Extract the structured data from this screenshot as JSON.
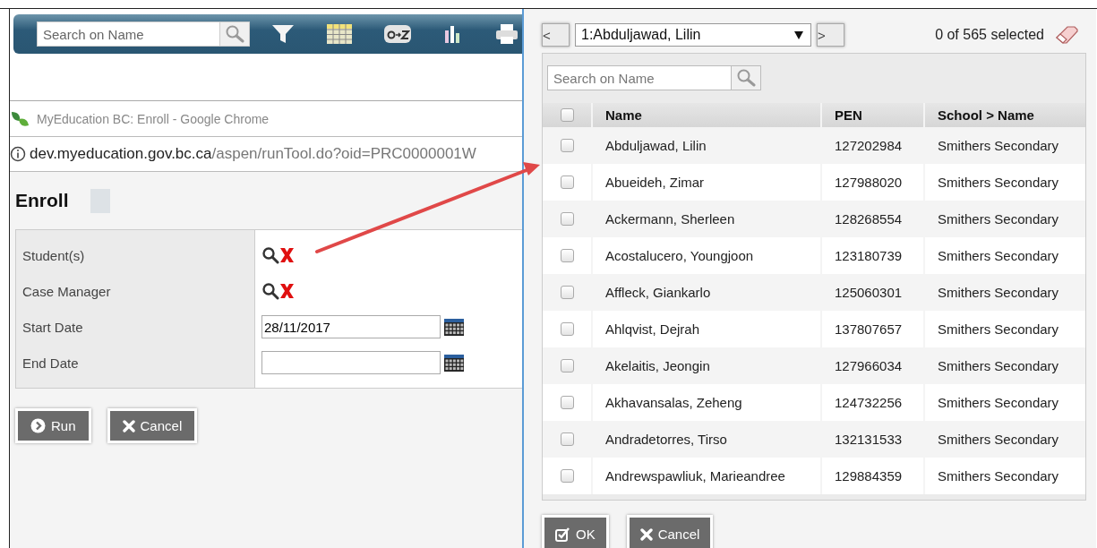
{
  "toolbar": {
    "search": {
      "placeholder": "Search on Name"
    }
  },
  "browser": {
    "title": "MyEducation BC: Enroll - Google Chrome",
    "url_host": "dev.myeducation.gov.bc.ca",
    "url_path": "/aspen/runTool.do?oid=PRC0000001W"
  },
  "page": {
    "title": "Enroll"
  },
  "form": {
    "fields": [
      {
        "label": "Student(s)",
        "kind": "picker"
      },
      {
        "label": "Case Manager",
        "kind": "picker"
      },
      {
        "label": "Start Date",
        "kind": "date",
        "value": "28/11/2017"
      },
      {
        "label": "End Date",
        "kind": "date"
      }
    ]
  },
  "buttons": [
    {
      "label": "Run",
      "kind": "run"
    },
    {
      "label": "Cancel",
      "kind": "cancel"
    }
  ],
  "picker": {
    "prev": "<",
    "current": "1:Abduljawad, Lilin",
    "next": ">",
    "selection_count": "0 of 565 selected",
    "search": {
      "placeholder": "Search on Name"
    },
    "select_all": {
      "checked": false
    },
    "columns": [
      "Name",
      "PEN",
      "School > Name"
    ],
    "rows": [
      {
        "name": "Abduljawad, Lilin",
        "pen": "127202984",
        "school": "Smithers Secondary",
        "checked": false
      },
      {
        "name": "Abueideh, Zimar",
        "pen": "127988020",
        "school": "Smithers Secondary",
        "checked": false
      },
      {
        "name": "Ackermann, Sherleen",
        "pen": "128268554",
        "school": "Smithers Secondary",
        "checked": false
      },
      {
        "name": "Acostalucero, Youngjoon",
        "pen": "123180739",
        "school": "Smithers Secondary",
        "checked": false
      },
      {
        "name": "Affleck, Giankarlo",
        "pen": "125060301",
        "school": "Smithers Secondary",
        "checked": false
      },
      {
        "name": "Ahlqvist, Dejrah",
        "pen": "137807657",
        "school": "Smithers Secondary",
        "checked": false
      },
      {
        "name": "Akelaitis, Jeongin",
        "pen": "127966034",
        "school": "Smithers Secondary",
        "checked": false
      },
      {
        "name": "Akhavansalas, Zeheng",
        "pen": "124732256",
        "school": "Smithers Secondary",
        "checked": false
      },
      {
        "name": "Andradetorres, Tirso",
        "pen": "132131533",
        "school": "Smithers Secondary",
        "checked": false
      },
      {
        "name": "Andrewspawliuk, Marieandree",
        "pen": "129884359",
        "school": "Smithers Secondary",
        "checked": false
      }
    ],
    "buttons": [
      {
        "label": "OK",
        "kind": "ok"
      },
      {
        "label": "Cancel",
        "kind": "cancel"
      }
    ]
  }
}
